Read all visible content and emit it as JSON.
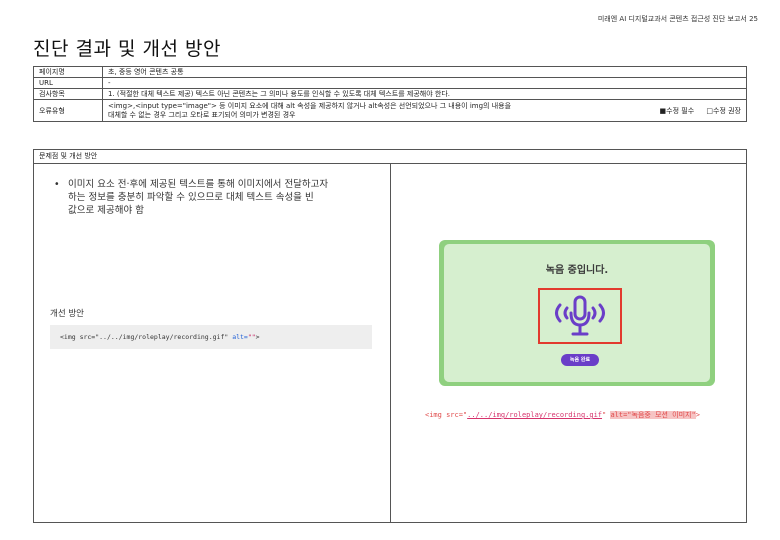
{
  "header": {
    "report_title": "미래엔 AI 디지털교과서 콘텐츠 접근성 진단 보고서  25"
  },
  "page_title": "진단 결과 및 개선 방안",
  "info_table": {
    "rows": [
      {
        "label": "페이지명",
        "value": "초, 중등 영어 콘텐츠 공통"
      },
      {
        "label": "URL",
        "value": "-"
      },
      {
        "label": "검사항목",
        "value": "1. (적절한 대체 텍스트 제공) 텍스트 아닌 콘텐츠는 그 의미나 용도를 인식할 수 있도록 대체 텍스트를 제공해야 한다."
      }
    ],
    "error_type": {
      "label": "오류유형",
      "desc_line1": "<img>,<input type=\"image\"> 등 이미지 요소에 대해 alt 속성을 제공하지 않거나 alt속성은 선언되었으나 그 내용이 img의 내용을",
      "desc_line2": "대체할 수 없는 경우 그리고 오타로 표기되어 의미가 변경된 경우",
      "option_required": "■수정 필수",
      "option_recommended": "□수정 권장"
    }
  },
  "section": {
    "header": "문제점 및 개선 방안",
    "bullet_symbol": "•",
    "bullet_line1": "이미지 요소 전·후에 제공된 텍스트를 통해 이미지에서 전달하고자",
    "bullet_line2": "하는 정보를 충분히 파악할 수 있으므로 대체 텍스트 속성을 빈",
    "bullet_line3": "값으로 제공해야 함",
    "improve_label": "개선 방안",
    "code_prefix": "<img src=\"../../img/roleplay/recording.gif\" ",
    "code_attr": "alt=",
    "code_value": "\"\"",
    "code_suffix": ">",
    "mock": {
      "title": "녹음 중입니다.",
      "stop_label": "녹음 완료",
      "accent_color": "#6a3ec8",
      "highlight_color": "#e23a2e"
    },
    "alt_code_prefix": "<img src=\"",
    "alt_code_url": "../../img/roleplay/recording.gif",
    "alt_code_mid": "\" ",
    "alt_code_attr": "alt=\"녹음중 모션 이미지\"",
    "alt_code_suffix": ">"
  }
}
